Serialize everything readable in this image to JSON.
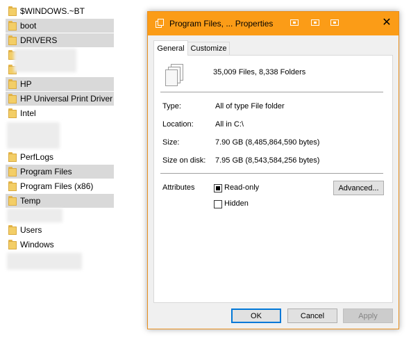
{
  "explorer": {
    "items": [
      {
        "label": "$WINDOWS.~BT"
      },
      {
        "label": "boot"
      },
      {
        "label": "DRIVERS"
      },
      {
        "label": "HP"
      },
      {
        "label": "HP Universal Print Driver"
      },
      {
        "label": "Intel"
      },
      {
        "label": "PerfLogs"
      },
      {
        "label": "Program Files"
      },
      {
        "label": "Program Files (x86)"
      },
      {
        "label": "Temp"
      },
      {
        "label": "Users"
      },
      {
        "label": "Windows"
      }
    ]
  },
  "dialog": {
    "title": "Program Files, ... Properties",
    "close_glyph": "✕",
    "tabs": [
      {
        "label": "General",
        "active": true
      },
      {
        "label": "Customize",
        "active": false
      }
    ],
    "summary": "35,009 Files, 8,338 Folders",
    "properties": [
      {
        "label": "Type:",
        "value": "All of type File folder"
      },
      {
        "label": "Location:",
        "value": "All in C:\\"
      },
      {
        "label": "Size:",
        "value": "7.90 GB (8,485,864,590 bytes)"
      },
      {
        "label": "Size on disk:",
        "value": "7.95 GB (8,543,584,256 bytes)"
      }
    ],
    "attributes_label": "Attributes",
    "readonly_label": "Read-only",
    "readonly_state": "indeterminate",
    "hidden_label": "Hidden",
    "hidden_state": "unchecked",
    "advanced_label": "Advanced...",
    "ok_label": "OK",
    "cancel_label": "Cancel",
    "apply_label": "Apply"
  },
  "colors": {
    "titlebar": "#fb9c17",
    "selection": "#d9d9d9",
    "default_button_border": "#0078d7"
  }
}
